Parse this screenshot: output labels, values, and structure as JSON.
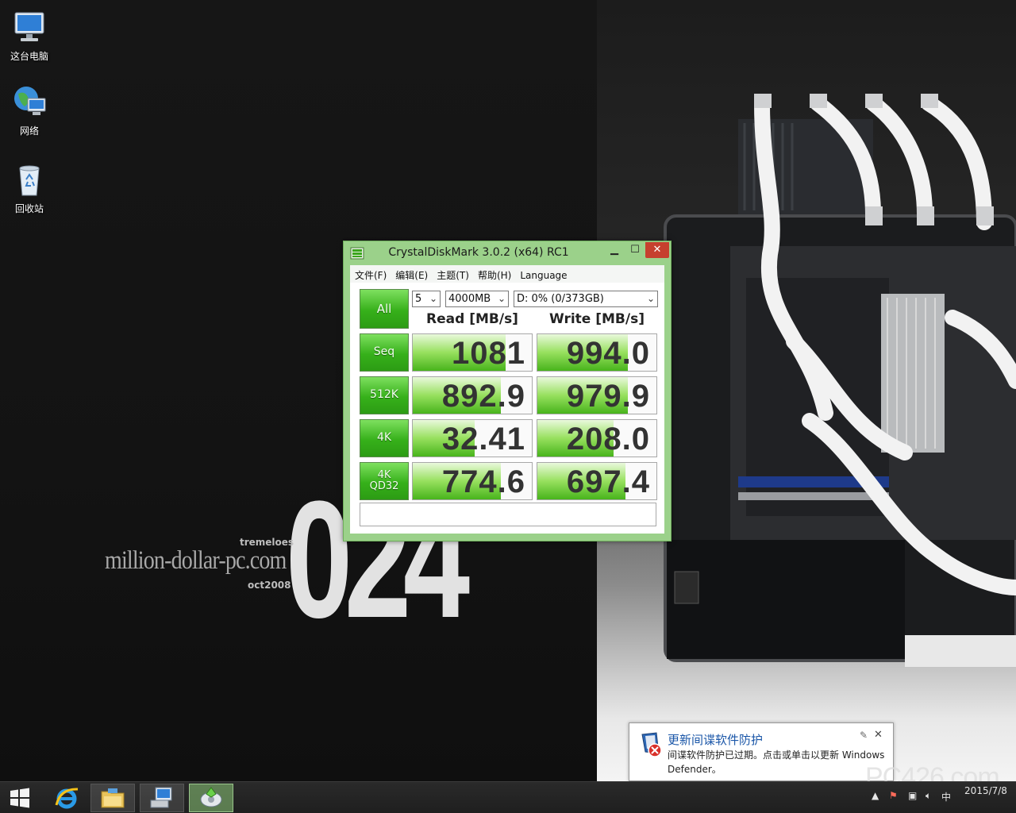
{
  "desktop": {
    "icons": [
      {
        "label": "这台电脑",
        "icon": "computer-icon"
      },
      {
        "label": "网络",
        "icon": "network-icon"
      },
      {
        "label": "回收站",
        "icon": "recycle-bin-icon"
      }
    ],
    "wallpaper": {
      "number": "024",
      "site": "million-dollar-pc.com",
      "line_top": "tremeloes",
      "line_bottom": "oct2008"
    }
  },
  "cdm": {
    "title": "CrystalDiskMark 3.0.2 (x64) RC1",
    "menu": [
      "文件(F)",
      "编辑(E)",
      "主题(T)",
      "帮助(H)",
      "Language"
    ],
    "all_label": "All",
    "count": "5",
    "size": "4000MB",
    "drive": "D: 0% (0/373GB)",
    "read_header": "Read [MB/s]",
    "write_header": "Write [MB/s]",
    "rows": [
      {
        "label": "Seq",
        "read": "1081",
        "write": "994.0",
        "read_fill": 0.78,
        "write_fill": 0.76
      },
      {
        "label": "512K",
        "read": "892.9",
        "write": "979.9",
        "read_fill": 0.74,
        "write_fill": 0.76
      },
      {
        "label": "4K",
        "read": "32.41",
        "write": "208.0",
        "read_fill": 0.52,
        "write_fill": 0.64
      },
      {
        "label": "4K\nQD32",
        "read": "774.6",
        "write": "697.4",
        "read_fill": 0.74,
        "write_fill": 0.74
      }
    ],
    "status": "",
    "accent": "#36b01a",
    "window_color": "#9bd18a"
  },
  "toast": {
    "title": "更新间谍软件防护",
    "body": "间谍软件防护已过期。点击或单击以更新 Windows Defender。",
    "icon": "defender-warning-icon"
  },
  "taskbar": {
    "items": [
      "start-icon",
      "ie-icon",
      "file-explorer-icon",
      "network-adapter-icon",
      "crystaldiskmark-icon"
    ],
    "date": "2015/7/8",
    "time": ""
  },
  "watermark": "PC426.com"
}
